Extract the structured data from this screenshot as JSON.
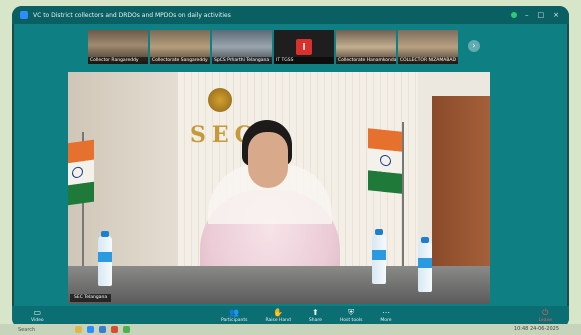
{
  "window": {
    "title": "VC to District collectors and DRDOs and MPDOs on daily activities",
    "controls": {
      "minimize": "–",
      "maximize": "□",
      "close": "×"
    }
  },
  "participants_strip": {
    "tiles": [
      {
        "name": "Collector Rangareddy"
      },
      {
        "name": "Collectorate Sangareddy"
      },
      {
        "name": "SpCS Prharthi Telangana"
      },
      {
        "name": "IT TGSS",
        "avatar_letter": "I"
      },
      {
        "name": "Collectorate Hanamkonda"
      },
      {
        "name": "COLLECTOR NIZAMABAD"
      }
    ],
    "next_icon": "chevron-right-icon"
  },
  "main_video": {
    "wall_sign": "SEC",
    "speaker_label": "SEC Telangana"
  },
  "controls": {
    "left": [
      {
        "label": "Video",
        "icon": "video-icon"
      }
    ],
    "middle": [
      {
        "label": "Participants",
        "icon": "participants-icon",
        "count": "57"
      },
      {
        "label": "Raise Hand",
        "icon": "hand-icon"
      },
      {
        "label": "Share",
        "icon": "share-icon"
      },
      {
        "label": "Host tools",
        "icon": "shield-icon"
      },
      {
        "label": "More",
        "icon": "more-icon"
      }
    ],
    "right": [
      {
        "label": "Leave",
        "icon": "leave-icon"
      }
    ]
  },
  "taskbar": {
    "search_text": "Search",
    "time": "10:48",
    "date": "24-06-2025"
  },
  "colors": {
    "screen_bg": "#0e7f83",
    "titlebar_bg": "#0a5f62",
    "leave": "#ff5b5b",
    "accent": "#2d8cff"
  }
}
